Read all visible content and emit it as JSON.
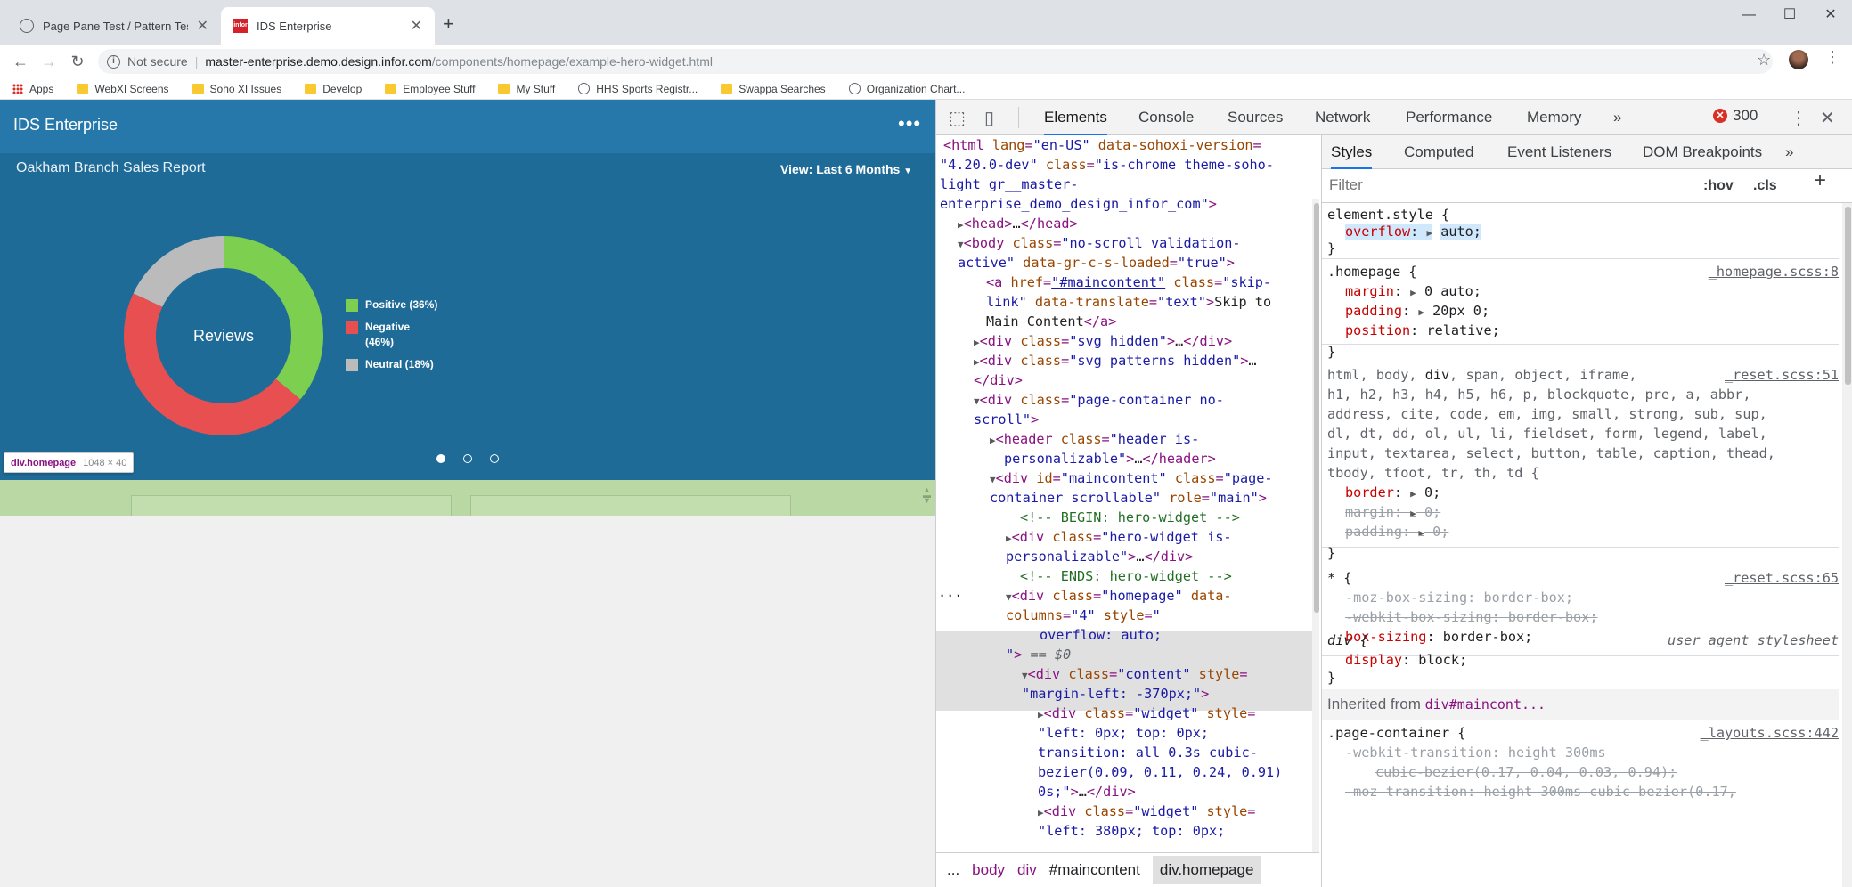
{
  "browser": {
    "tabs": [
      {
        "title": "Page Pane Test / Pattern Test",
        "active": false
      },
      {
        "title": "IDS Enterprise",
        "active": true
      }
    ],
    "window_controls": {
      "minimize": "—",
      "maximize": "☐",
      "close": "✕"
    },
    "address": {
      "security": "Not secure",
      "host": "master-enterprise.demo.design.infor.com",
      "path": "/components/homepage/example-hero-widget.html"
    },
    "bookmarks": [
      {
        "label": "Apps",
        "icon": "apps-grid-icon"
      },
      {
        "label": "WebXI Screens",
        "icon": "folder-icon"
      },
      {
        "label": "Soho XI Issues",
        "icon": "folder-icon"
      },
      {
        "label": "Develop",
        "icon": "folder-icon"
      },
      {
        "label": "Employee Stuff",
        "icon": "folder-icon"
      },
      {
        "label": "My Stuff",
        "icon": "folder-icon"
      },
      {
        "label": "HHS Sports Registr...",
        "icon": "globe-icon"
      },
      {
        "label": "Swappa Searches",
        "icon": "folder-icon"
      },
      {
        "label": "Organization Chart...",
        "icon": "globe-icon"
      }
    ]
  },
  "app": {
    "title": "IDS Enterprise",
    "more_glyph": "•••",
    "hero": {
      "report_title": "Oakham Branch Sales Report",
      "view_selector": "View: Last 6 Months",
      "center_label": "Reviews",
      "legend": [
        {
          "label": "Positive (36%)",
          "color": "#7ccf4f"
        },
        {
          "label": "Negative (46%)",
          "color": "#e84f51"
        },
        {
          "label": "Neutral (18%)",
          "color": "#bbbbbb"
        }
      ],
      "pager_dots": [
        true,
        false,
        false
      ]
    },
    "inspect_tooltip": {
      "name": "div.homepage",
      "size": "1048 × 40"
    }
  },
  "chart_data": {
    "type": "pie",
    "center_label": "Reviews",
    "categories": [
      "Positive",
      "Negative",
      "Neutral"
    ],
    "values": [
      36,
      46,
      18
    ],
    "unit": "%",
    "colors": [
      "#7ccf4f",
      "#e84f51",
      "#bbbbbb"
    ]
  },
  "devtools": {
    "tabs": [
      "Elements",
      "Console",
      "Sources",
      "Network",
      "Performance",
      "Memory"
    ],
    "more_tabs": "»",
    "error_count": "300",
    "styles_tabs": [
      "Styles",
      "Computed",
      "Event Listeners",
      "DOM Breakpoints"
    ],
    "filter_placeholder": "Filter",
    "hov": ":hov",
    "cls": ".cls",
    "breadcrumbs": [
      "...",
      "body",
      "div",
      "#maincontent",
      "div.homepage"
    ],
    "inherited_from": "Inherited from",
    "inherited_selector": "div#maincont..."
  }
}
